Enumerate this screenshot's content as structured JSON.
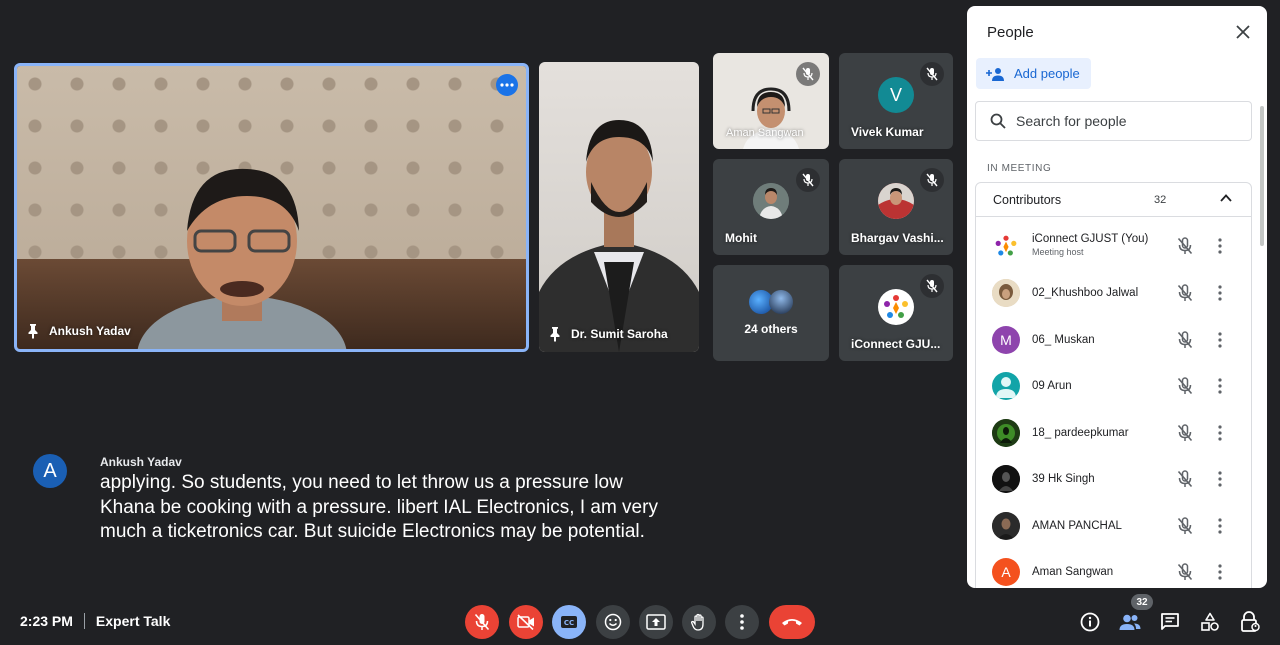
{
  "tiles": {
    "main": {
      "name": "Ankush Yadav"
    },
    "sumit": {
      "name": "Dr. Sumit Saroha"
    },
    "aman": {
      "name": "Aman Sangwan"
    },
    "vivek": {
      "name": "Vivek Kumar",
      "initial": "V"
    },
    "mohit": {
      "name": "Mohit"
    },
    "bhargav": {
      "name": "Bhargav Vashi..."
    },
    "others": {
      "label": "24 others"
    },
    "iconnect": {
      "name": "iConnect GJU..."
    }
  },
  "caption": {
    "initial": "A",
    "speaker": "Ankush Yadav",
    "text": "applying. So students, you need to let throw us a pressure low Khana be cooking with a pressure. libert IAL Electronics, I am very much a ticketronics car. But suicide Electronics may be potential."
  },
  "bottom_bar": {
    "time": "2:23 PM",
    "meeting_name": "Expert Talk",
    "people_badge": "32"
  },
  "panel": {
    "title": "People",
    "add_people": "Add people",
    "search_placeholder": "Search for people",
    "section_label": "IN MEETING",
    "group_name": "Contributors",
    "group_count": "32",
    "participants": [
      {
        "name": "iConnect GJUST (You)",
        "sub": "Meeting host"
      },
      {
        "name": "02_Khushboo Jalwal"
      },
      {
        "name": "06_ Muskan",
        "initial": "M"
      },
      {
        "name": "09 Arun"
      },
      {
        "name": "18_ pardeepkumar"
      },
      {
        "name": "39 Hk Singh"
      },
      {
        "name": "AMAN PANCHAL"
      },
      {
        "name": "Aman Sangwan",
        "initial": "A"
      }
    ]
  },
  "colors": {
    "background": "#202124",
    "tile": "#3c4043",
    "accent_blue": "#8ab4f8",
    "end_call_red": "#ea4335",
    "panel_bg": "#ffffff"
  }
}
